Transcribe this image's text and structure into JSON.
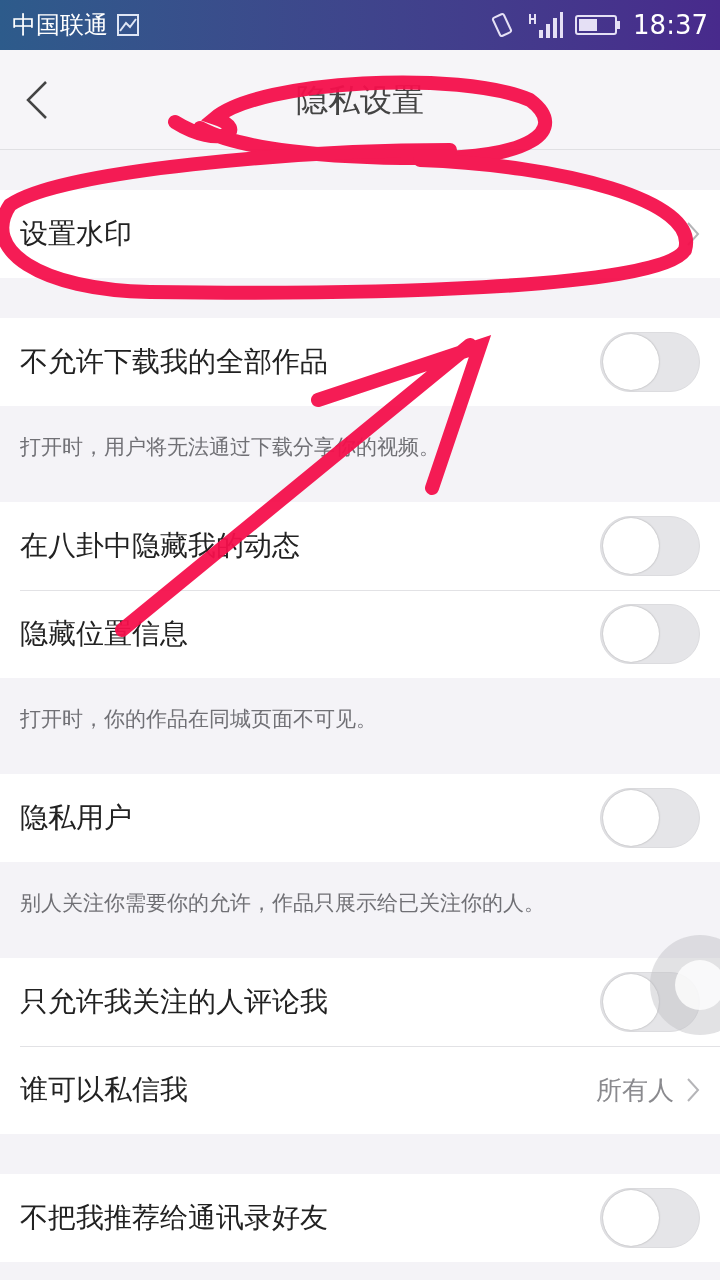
{
  "status_bar": {
    "carrier": "中国联通",
    "time": "18:37"
  },
  "header": {
    "title": "隐私设置"
  },
  "sections": [
    {
      "rows": [
        {
          "kind": "link",
          "label": "设置水印"
        }
      ]
    },
    {
      "rows": [
        {
          "kind": "toggle",
          "label": "不允许下载我的全部作品",
          "on": false
        }
      ],
      "hint": "打开时，用户将无法通过下载分享你的视频。"
    },
    {
      "rows": [
        {
          "kind": "toggle",
          "label": "在八卦中隐藏我的动态",
          "on": false
        },
        {
          "kind": "toggle",
          "label": "隐藏位置信息",
          "on": false
        }
      ],
      "hint": "打开时，你的作品在同城页面不可见。"
    },
    {
      "rows": [
        {
          "kind": "toggle",
          "label": "隐私用户",
          "on": false
        }
      ],
      "hint": "别人关注你需要你的允许，作品只展示给已关注你的人。"
    },
    {
      "rows": [
        {
          "kind": "toggle",
          "label": "只允许我关注的人评论我",
          "on": false
        },
        {
          "kind": "link",
          "label": "谁可以私信我",
          "value": "所有人"
        }
      ]
    },
    {
      "rows": [
        {
          "kind": "toggle",
          "label": "不把我推荐给通讯录好友",
          "on": false
        }
      ]
    }
  ]
}
